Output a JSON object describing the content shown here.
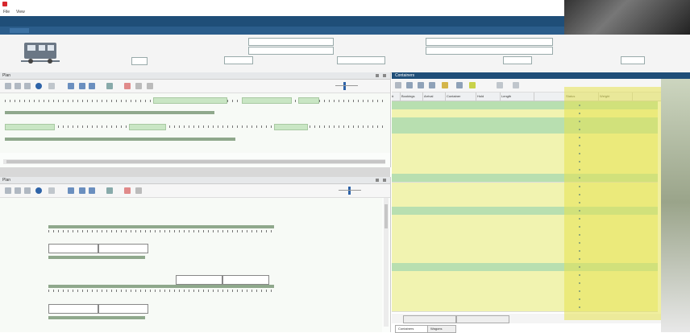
{
  "window": {
    "title": ""
  },
  "menu": {
    "items": [
      "File",
      "View"
    ]
  },
  "info": {
    "labels": [
      "",
      "",
      "",
      "",
      "",
      "",
      "",
      "",
      ""
    ],
    "values": [
      "",
      "",
      "",
      "",
      "",
      "",
      "",
      "",
      ""
    ],
    "right_label": ""
  },
  "panels": {
    "upper": {
      "title": "Plan"
    },
    "lower": {
      "title": "Plan"
    },
    "right": {
      "title": "Containers"
    }
  },
  "table": {
    "columns": [
      "#",
      "Bookings",
      "Arrival",
      "Container",
      "Hold",
      "Length",
      "Status",
      "Weight"
    ],
    "rows": [
      {
        "cells": [
          "",
          "",
          "",
          "",
          "",
          "",
          "",
          ""
        ],
        "status": "green"
      },
      {
        "cells": [
          "",
          "",
          "",
          "",
          "",
          "",
          "",
          ""
        ],
        "status": "yellow"
      },
      {
        "cells": [
          "",
          "",
          "",
          "",
          "",
          "",
          "",
          ""
        ],
        "status": "green"
      },
      {
        "cells": [
          "",
          "",
          "",
          "",
          "",
          "",
          "",
          ""
        ],
        "status": "green"
      },
      {
        "cells": [
          "",
          "",
          "",
          "",
          "",
          "",
          "",
          ""
        ],
        "status": "yellow"
      },
      {
        "cells": [
          "",
          "",
          "",
          "",
          "",
          "",
          "",
          ""
        ],
        "status": "yellow"
      },
      {
        "cells": [
          "",
          "",
          "",
          "",
          "",
          "",
          "",
          ""
        ],
        "status": "yellow"
      },
      {
        "cells": [
          "",
          "",
          "",
          "",
          "",
          "",
          "",
          ""
        ],
        "status": "yellow"
      },
      {
        "cells": [
          "",
          "",
          "",
          "",
          "",
          "",
          "",
          ""
        ],
        "status": "yellow"
      },
      {
        "cells": [
          "",
          "",
          "",
          "",
          "",
          "",
          "",
          ""
        ],
        "status": "green"
      },
      {
        "cells": [
          "",
          "",
          "",
          "",
          "",
          "",
          "",
          ""
        ],
        "status": "yellow"
      },
      {
        "cells": [
          "",
          "",
          "",
          "",
          "",
          "",
          "",
          ""
        ],
        "status": "yellow"
      },
      {
        "cells": [
          "",
          "",
          "",
          "",
          "",
          "",
          "",
          ""
        ],
        "status": "yellow"
      },
      {
        "cells": [
          "",
          "",
          "",
          "",
          "",
          "",
          "",
          ""
        ],
        "status": "green"
      },
      {
        "cells": [
          "",
          "",
          "",
          "",
          "",
          "",
          "",
          ""
        ],
        "status": "yellow"
      },
      {
        "cells": [
          "",
          "",
          "",
          "",
          "",
          "",
          "",
          ""
        ],
        "status": "yellow"
      },
      {
        "cells": [
          "",
          "",
          "",
          "",
          "",
          "",
          "",
          ""
        ],
        "status": "yellow"
      },
      {
        "cells": [
          "",
          "",
          "",
          "",
          "",
          "",
          "",
          ""
        ],
        "status": "yellow"
      },
      {
        "cells": [
          "",
          "",
          "",
          "",
          "",
          "",
          "",
          ""
        ],
        "status": "yellow"
      },
      {
        "cells": [
          "",
          "",
          "",
          "",
          "",
          "",
          "",
          ""
        ],
        "status": "yellow"
      },
      {
        "cells": [
          "",
          "",
          "",
          "",
          "",
          "",
          "",
          ""
        ],
        "status": "green"
      },
      {
        "cells": [
          "",
          "",
          "",
          "",
          "",
          "",
          "",
          ""
        ],
        "status": "yellow"
      },
      {
        "cells": [
          "",
          "",
          "",
          "",
          "",
          "",
          "",
          ""
        ],
        "status": "yellow"
      },
      {
        "cells": [
          "",
          "",
          "",
          "",
          "",
          "",
          "",
          ""
        ],
        "status": "yellow"
      },
      {
        "cells": [
          "",
          "",
          "",
          "",
          "",
          "",
          "",
          ""
        ],
        "status": "yellow"
      },
      {
        "cells": [
          "",
          "",
          "",
          "",
          "",
          "",
          "",
          ""
        ],
        "status": "yellow"
      }
    ]
  },
  "bottom_tabs": [
    "Containers",
    "Wagons"
  ],
  "bottom_buttons": [
    "",
    ""
  ],
  "colors": {
    "row_green": "#b8dfb0",
    "row_yellow": "#f1f3b0",
    "accent_blue": "#1f4e78",
    "track_green": "#c9e6c4"
  }
}
